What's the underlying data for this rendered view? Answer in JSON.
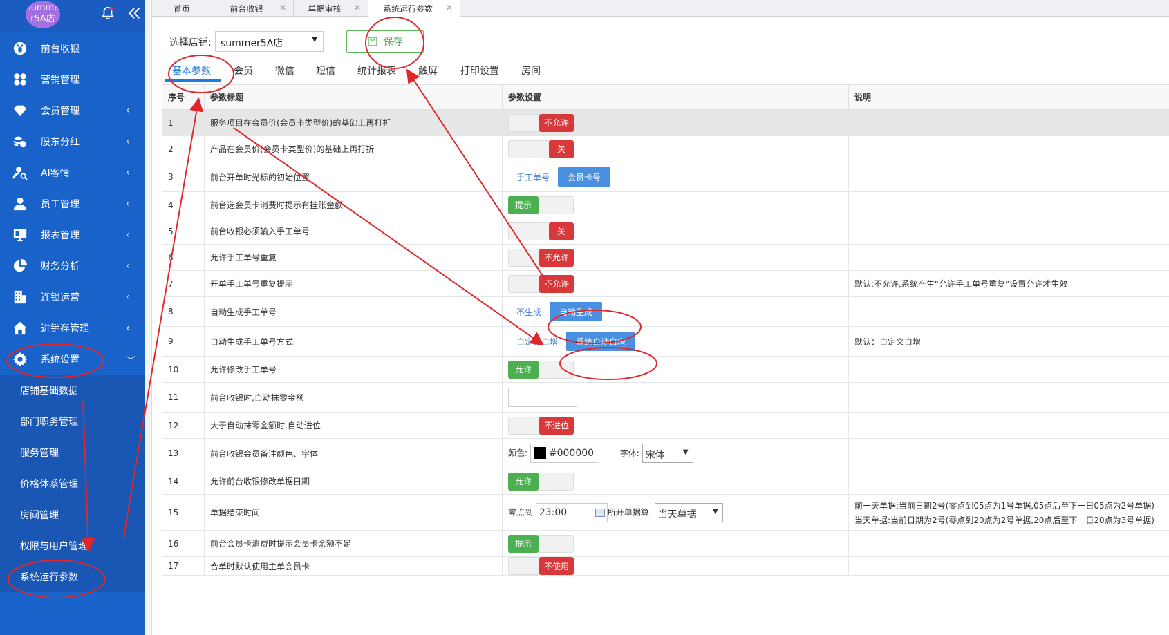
{
  "sidebar": {
    "avatar_text": "summe r5A店",
    "menu": [
      {
        "label": "前台收银",
        "icon": "yen-icon",
        "chevron": false
      },
      {
        "label": "营销管理",
        "icon": "grid-icon",
        "chevron": false
      },
      {
        "label": "会员管理",
        "icon": "diamond-icon",
        "chevron": true
      },
      {
        "label": "股东分红",
        "icon": "coins-icon",
        "chevron": true
      },
      {
        "label": "AI客情",
        "icon": "user-search-icon",
        "chevron": true
      },
      {
        "label": "员工管理",
        "icon": "user-icon",
        "chevron": true
      },
      {
        "label": "报表管理",
        "icon": "monitor-icon",
        "chevron": true
      },
      {
        "label": "财务分析",
        "icon": "pie-icon",
        "chevron": true
      },
      {
        "label": "连锁运营",
        "icon": "building-icon",
        "chevron": true
      },
      {
        "label": "进销存管理",
        "icon": "home-icon",
        "chevron": true
      },
      {
        "label": "系统设置",
        "icon": "gear-icon",
        "chevron": true
      }
    ],
    "submenu": [
      "店铺基础数据",
      "部门职务管理",
      "服务管理",
      "价格体系管理",
      "房间管理",
      "权限与用户管理",
      "系统运行参数"
    ]
  },
  "tabs": [
    {
      "label": "首页",
      "closable": false
    },
    {
      "label": "前台收银",
      "closable": true
    },
    {
      "label": "单据审核",
      "closable": true
    },
    {
      "label": "系统运行参数",
      "closable": true
    }
  ],
  "toolbar": {
    "store_label": "选择店铺:",
    "store_value": "summer5A店",
    "save_label": "保存"
  },
  "subtabs": [
    "基本参数",
    "会员",
    "微信",
    "短信",
    "统计报表",
    "触屏",
    "打印设置",
    "房间"
  ],
  "table": {
    "headers": [
      "序号",
      "参数标题",
      "参数设置",
      "说明"
    ],
    "rows": [
      {
        "no": "1",
        "title": "服务项目在会员价(会员卡类型价)的基础上再打折",
        "control": {
          "type": "toggle",
          "state": "off",
          "text": "不允许"
        },
        "note": ""
      },
      {
        "no": "2",
        "title": "产品在会员价(会员卡类型价)的基础上再打折",
        "control": {
          "type": "toggle",
          "state": "off",
          "text": "关"
        },
        "note": ""
      },
      {
        "no": "3",
        "title": "前台开单时光标的初始位置",
        "control": {
          "type": "segment",
          "a": "手工单号",
          "b": "会员卡号"
        },
        "note": ""
      },
      {
        "no": "4",
        "title": "前台选会员卡消费时提示有挂账金额",
        "control": {
          "type": "toggle",
          "state": "on",
          "text": "提示"
        },
        "note": ""
      },
      {
        "no": "5",
        "title": "前台收银必须输入手工单号",
        "control": {
          "type": "toggle",
          "state": "off",
          "text": "关"
        },
        "note": ""
      },
      {
        "no": "6",
        "title": "允许手工单号重复",
        "control": {
          "type": "toggle",
          "state": "off",
          "text": "不允许"
        },
        "note": ""
      },
      {
        "no": "7",
        "title": "开单手工单号重复提示",
        "control": {
          "type": "toggle",
          "state": "off",
          "text": "不允许"
        },
        "note": "默认:不允许,系统产生“允许手工单号重复”设置允许才生效"
      },
      {
        "no": "8",
        "title": "自动生成手工单号",
        "control": {
          "type": "segment",
          "a": "不生成",
          "b": "自动生成"
        },
        "note": ""
      },
      {
        "no": "9",
        "title": "自动生成手工单号方式",
        "control": {
          "type": "segment",
          "a": "自定义自增",
          "b": "系统自动自增"
        },
        "note": "默认：自定义自增"
      },
      {
        "no": "10",
        "title": "允许修改手工单号",
        "control": {
          "type": "toggle",
          "state": "on",
          "text": "允许"
        },
        "note": ""
      },
      {
        "no": "11",
        "title": "前台收银时,自动抹零金额",
        "control": {
          "type": "input"
        },
        "note": ""
      },
      {
        "no": "12",
        "title": "大于自动抹零金额时,自动进位",
        "control": {
          "type": "toggle",
          "state": "off",
          "text": "不进位"
        },
        "note": ""
      },
      {
        "no": "13",
        "title": "前台收银会员备注颜色、字体",
        "control": {
          "type": "color",
          "color_label": "颜色:",
          "color_value": "#000000",
          "font_label": "字体:",
          "font_value": "宋体"
        },
        "note": ""
      },
      {
        "no": "14",
        "title": "允许前台收银修改单据日期",
        "control": {
          "type": "toggle",
          "state": "on",
          "text": "允许"
        },
        "note": ""
      },
      {
        "no": "15",
        "title": "单据结束时间",
        "control": {
          "type": "time",
          "prefix": "零点到",
          "time": "23:00",
          "mid": "所开单据算",
          "select": "当天单据"
        },
        "note": "前一天单据:当前日期2号(零点到05点为1号单据,05点后至下一日05点为2号单据)",
        "note2": "当天单据:当前日期为2号(零点到20点为2号单据,20点后至下一日20点为3号单据)"
      },
      {
        "no": "16",
        "title": "前台会员卡消费时提示会员卡余额不足",
        "control": {
          "type": "toggle",
          "state": "on",
          "text": "提示"
        },
        "note": ""
      },
      {
        "no": "17",
        "title": "合单时默认使用主单会员卡",
        "control": {
          "type": "toggle",
          "state": "off",
          "text": "不使用"
        },
        "note": ""
      }
    ]
  },
  "colors": {
    "sidebar": "#1862c9",
    "accent": "#1d7be0",
    "red": "#d9383a",
    "green": "#4caf50",
    "annotation": "#e0282c"
  }
}
